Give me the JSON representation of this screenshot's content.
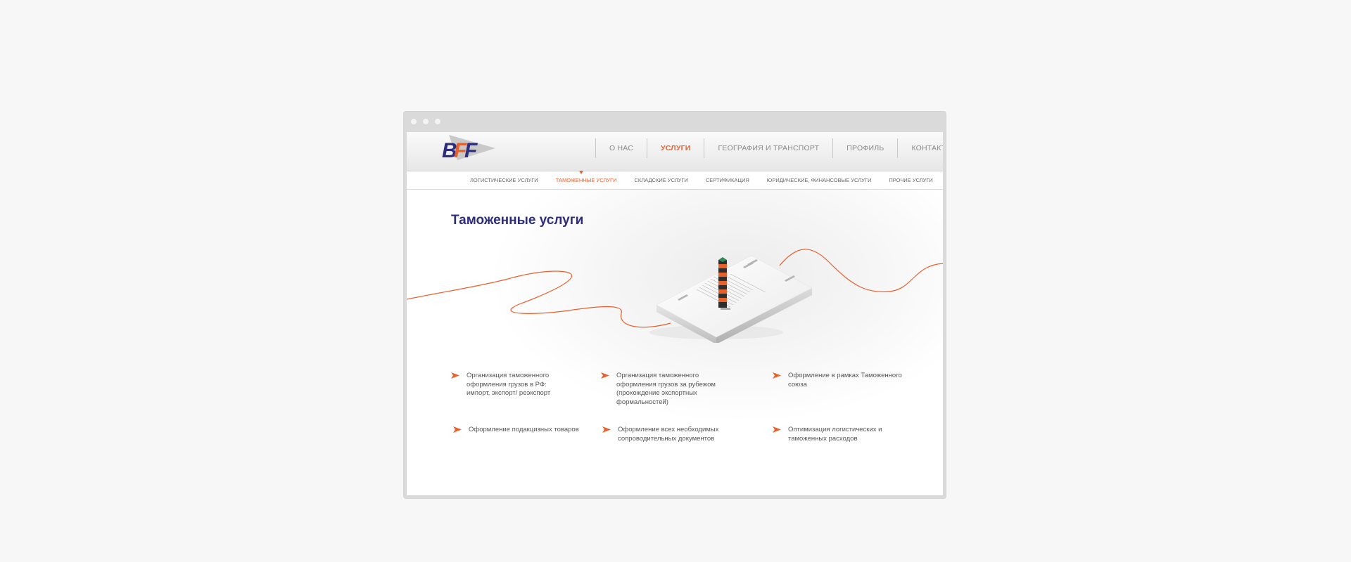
{
  "logo": {
    "text": "BFF",
    "colors": {
      "primary": "#2d2c7e",
      "secondary": "#e8602c"
    }
  },
  "nav": {
    "items": [
      {
        "label": "О НАС",
        "active": false
      },
      {
        "label": "УСЛУГИ",
        "active": true
      },
      {
        "label": "ГЕОГРАФИЯ И ТРАНСПОРТ",
        "active": false
      },
      {
        "label": "ПРОФИЛЬ",
        "active": false
      },
      {
        "label": "КОНТАКТЫ",
        "active": false
      }
    ]
  },
  "subnav": {
    "items": [
      {
        "label": "ЛОГИСТИЧЕСКИЕ УСЛУГИ",
        "active": false
      },
      {
        "label": "ТАМОЖЕННЫЕ УСЛУГИ",
        "active": true
      },
      {
        "label": "СКЛАДСКИЕ УСЛУГИ",
        "active": false
      },
      {
        "label": "СЕРТИФИКАЦИЯ",
        "active": false
      },
      {
        "label": "ЮРИДИЧЕСКИЕ, ФИНАНСОВЫЕ  УСЛУГИ",
        "active": false
      },
      {
        "label": "ПРОЧИЕ УСЛУГИ",
        "active": false
      }
    ]
  },
  "page": {
    "title": "Таможенные услуги"
  },
  "services": [
    {
      "text": "Организация таможенного оформления грузов в РФ: импорт, экспорт/ реэкспорт"
    },
    {
      "text": "Организация таможенного оформления грузов за рубежом (прохождение экспортных формальностей)"
    },
    {
      "text": "Оформление в рамках Таможенного союза"
    },
    {
      "text": "Оформление подакцизных товаров"
    },
    {
      "text": "Оформление всех необходимых сопроводительных документов"
    },
    {
      "text": "Оптимизация логистических и таможенных расходов"
    }
  ],
  "colors": {
    "accent": "#e8602c",
    "title": "#2d2c7e"
  },
  "icons": {
    "service_marker": "arrow-flag-icon"
  }
}
